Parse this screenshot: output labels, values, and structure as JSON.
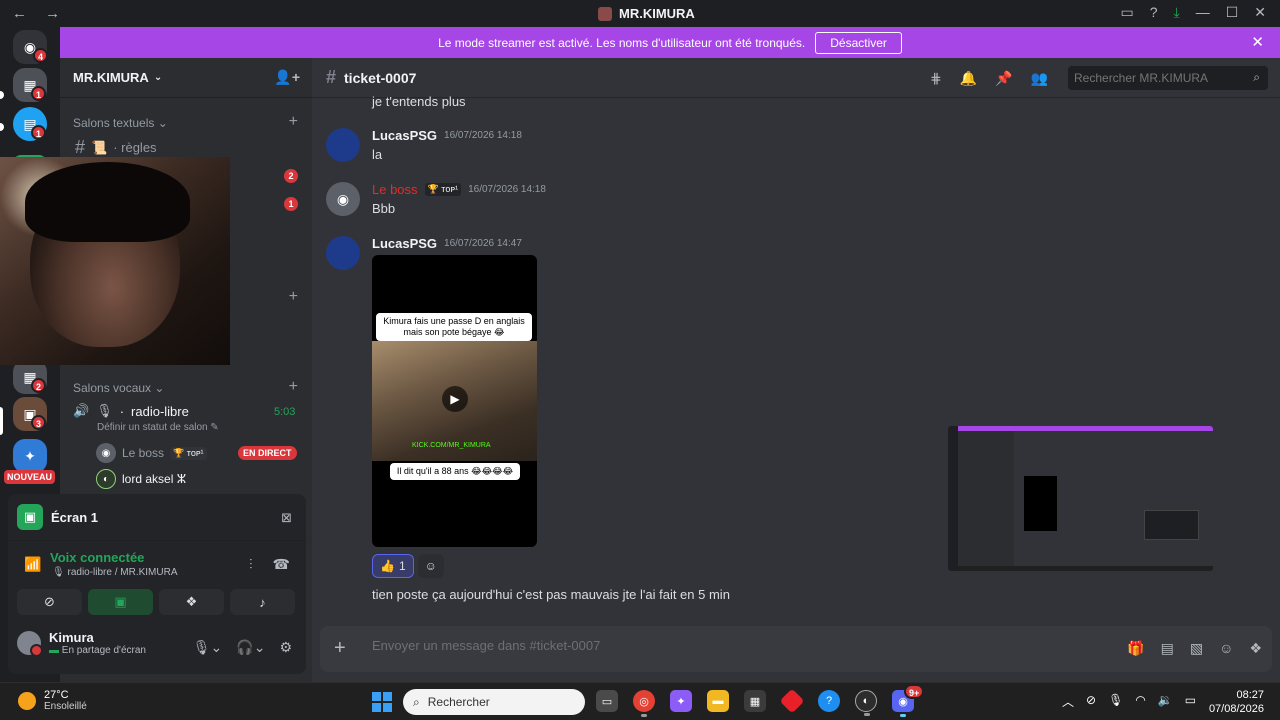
{
  "window": {
    "title": "MR.KIMURA",
    "back": "←",
    "forward": "→"
  },
  "banner": {
    "text": "Le mode streamer est activé. Les noms d'utilisateur ont été tronqués.",
    "button": "Désactiver"
  },
  "guilds": {
    "home_badge": "4",
    "items": [
      {
        "badge": "1"
      },
      {
        "badge": "1"
      },
      {
        "badge": "2"
      },
      {
        "badge": "3"
      }
    ],
    "new_label": "NOUVEAU"
  },
  "sidebar": {
    "server_name": "MR.KIMURA",
    "text_category": "Salons textuels",
    "channels": [
      {
        "emoji": "📜",
        "name": "· règles"
      }
    ],
    "unread_badges": [
      "2",
      "1"
    ],
    "voice_category": "Salons vocaux",
    "voice_channel": {
      "name": "radio-libre",
      "time": "5:03",
      "status_prompt": "Définir un statut de salon"
    },
    "voice_users": [
      {
        "name": "Le boss",
        "tag": "🏆 ᴛᴏᴘ¹",
        "live": "EN DIRECT"
      },
      {
        "name": "lord aksel ⵣ"
      }
    ]
  },
  "stream_panel": {
    "screen_label": "Écran 1",
    "voice_title": "Voix connectée",
    "voice_location": "radio-libre / MR.KIMURA"
  },
  "user": {
    "name": "Kimura",
    "status": "En partage d'écran"
  },
  "chat": {
    "channel": "ticket-0007",
    "search_placeholder": "Rechercher MR.KIMURA",
    "previous_line": "je t'entends plus",
    "messages": [
      {
        "author": "LucasPSG",
        "time": "16/07/2026 14:18",
        "text": "la"
      },
      {
        "author": "Le boss",
        "tag": "🏆 ᴛᴏᴘ¹",
        "time": "16/07/2026 14:18",
        "text": "Bbb"
      },
      {
        "author": "LucasPSG",
        "time": "16/07/2026 14:47"
      }
    ],
    "video": {
      "caption_top": "Kimura fais une passe D en anglais mais son pote bégaye 😂",
      "watermark": "KICK.COM/MR_KIMURA",
      "caption_bottom": "Il dit qu'il a 88 ans 😂😂😂😂"
    },
    "reaction": {
      "emoji": "👍",
      "count": "1"
    },
    "final_message": "tien poste ça aujourd'hui c'est pas mauvais jte l'ai fait en 5 min",
    "composer_placeholder": "Envoyer un message dans #ticket-0007"
  },
  "taskbar": {
    "temperature": "27°C",
    "weather": "Ensoleillé",
    "search_label": "Rechercher",
    "discord_badge": "9+",
    "time": "08:27",
    "date": "07/08/2026"
  },
  "colors": {
    "accent": "#5865f2",
    "streamer_banner": "#a646e6",
    "online_green": "#23a55a",
    "alert_red": "#da373c"
  }
}
